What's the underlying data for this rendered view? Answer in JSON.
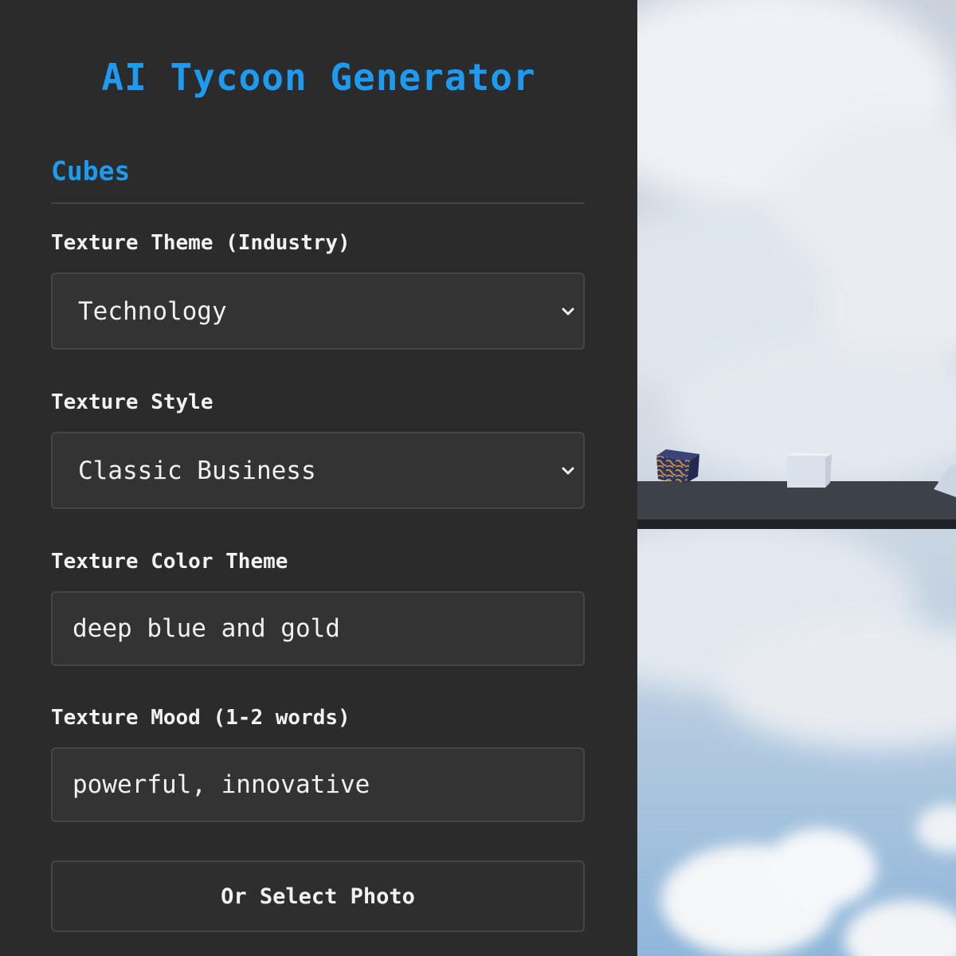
{
  "app": {
    "title": "AI Tycoon Generator"
  },
  "section": {
    "title": "Cubes"
  },
  "fields": {
    "theme": {
      "label": "Texture Theme (Industry)",
      "value": "Technology"
    },
    "style": {
      "label": "Texture Style",
      "value": "Classic Business"
    },
    "color": {
      "label": "Texture Color Theme",
      "value": "deep blue and gold"
    },
    "mood": {
      "label": "Texture Mood (1-2 words)",
      "value": "powerful, innovative"
    }
  },
  "photo_button": {
    "label": "Or Select Photo"
  },
  "icons": {
    "select_arrow": "chevron-down-icon"
  },
  "colors": {
    "accent": "#1e9bf0",
    "panel_bg": "#2b2b2b",
    "control_bg": "#333333",
    "control_border": "#454545",
    "text": "#f0f0f0"
  }
}
